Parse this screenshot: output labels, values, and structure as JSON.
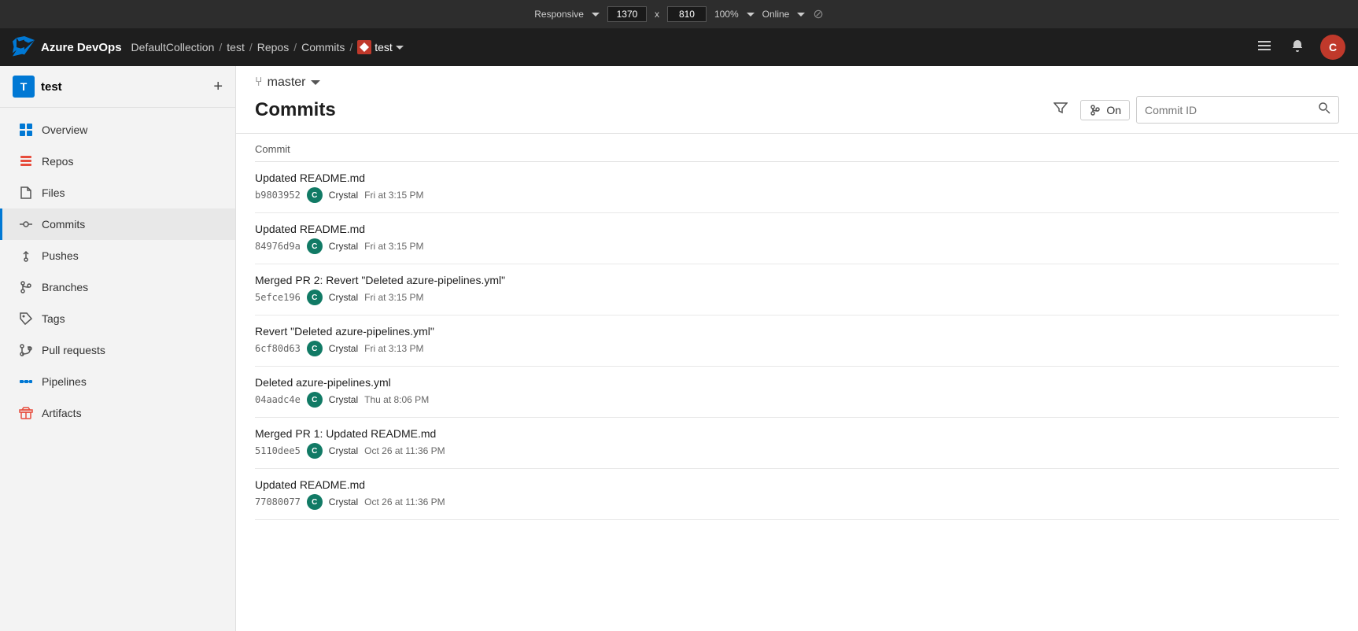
{
  "browser": {
    "responsive_label": "Responsive",
    "width": "1370",
    "x_label": "x",
    "height": "810",
    "zoom": "100%",
    "status": "Online"
  },
  "topnav": {
    "brand": "Azure DevOps",
    "breadcrumbs": [
      {
        "label": "DefaultCollection",
        "link": true
      },
      {
        "label": "/",
        "sep": true
      },
      {
        "label": "test",
        "link": true
      },
      {
        "label": "/",
        "sep": true
      },
      {
        "label": "Repos",
        "link": true
      },
      {
        "label": "/",
        "sep": true
      },
      {
        "label": "Commits",
        "link": true
      },
      {
        "label": "/",
        "sep": true
      }
    ],
    "repo_name": "test",
    "avatar_initials": "C"
  },
  "sidebar": {
    "project_initial": "T",
    "project_name": "test",
    "nav_items": [
      {
        "id": "overview",
        "label": "Overview",
        "icon": "overview"
      },
      {
        "id": "repos",
        "label": "Repos",
        "icon": "repos",
        "active": false
      },
      {
        "id": "files",
        "label": "Files",
        "icon": "files"
      },
      {
        "id": "commits",
        "label": "Commits",
        "icon": "commits",
        "active": true
      },
      {
        "id": "pushes",
        "label": "Pushes",
        "icon": "pushes"
      },
      {
        "id": "branches",
        "label": "Branches",
        "icon": "branches"
      },
      {
        "id": "tags",
        "label": "Tags",
        "icon": "tags"
      },
      {
        "id": "pullrequests",
        "label": "Pull requests",
        "icon": "pullreq"
      },
      {
        "id": "pipelines",
        "label": "Pipelines",
        "icon": "pipelines"
      },
      {
        "id": "artifacts",
        "label": "Artifacts",
        "icon": "artifacts"
      }
    ]
  },
  "page": {
    "branch": "master",
    "title": "Commits",
    "on_label": "On",
    "commit_id_placeholder": "Commit ID",
    "table_header": "Commit",
    "commits": [
      {
        "message": "Updated README.md",
        "hash": "b9803952",
        "author": "Crystal",
        "time": "Fri at 3:15 PM"
      },
      {
        "message": "Updated README.md",
        "hash": "84976d9a",
        "author": "Crystal",
        "time": "Fri at 3:15 PM"
      },
      {
        "message": "Merged PR 2: Revert \"Deleted azure-pipelines.yml\"",
        "hash": "5efce196",
        "author": "Crystal",
        "time": "Fri at 3:15 PM"
      },
      {
        "message": "Revert \"Deleted azure-pipelines.yml\"",
        "hash": "6cf80d63",
        "author": "Crystal",
        "time": "Fri at 3:13 PM"
      },
      {
        "message": "Deleted azure-pipelines.yml",
        "hash": "04aadc4e",
        "author": "Crystal",
        "time": "Thu at 8:06 PM"
      },
      {
        "message": "Merged PR 1: Updated README.md",
        "hash": "5110dee5",
        "author": "Crystal",
        "time": "Oct 26 at 11:36 PM"
      },
      {
        "message": "Updated README.md",
        "hash": "77080077",
        "author": "Crystal",
        "time": "Oct 26 at 11:36 PM"
      }
    ]
  }
}
